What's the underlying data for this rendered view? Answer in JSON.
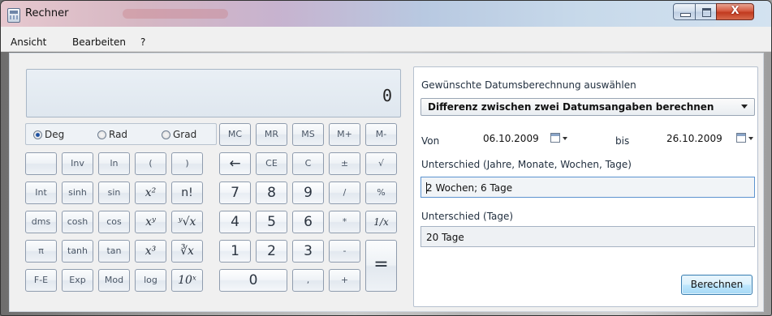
{
  "window": {
    "title": "Rechner",
    "controls": {
      "minimize": "minimize-icon",
      "maximize": "maximize-icon",
      "close": "X"
    }
  },
  "menu": [
    "Ansicht",
    "Bearbeiten",
    "?"
  ],
  "display": {
    "value": "0"
  },
  "angle_modes": [
    {
      "label": "Deg",
      "selected": true
    },
    {
      "label": "Rad",
      "selected": false
    },
    {
      "label": "Grad",
      "selected": false
    }
  ],
  "keys": {
    "row0": [
      "MC",
      "MR",
      "MS",
      "M+",
      "M-"
    ],
    "row1": [
      "",
      "Inv",
      "ln",
      "(",
      ")",
      "←",
      "CE",
      "C",
      "±",
      "√"
    ],
    "row2": [
      "Int",
      "sinh",
      "sin",
      "x²",
      "n!",
      "7",
      "8",
      "9",
      "/",
      "%"
    ],
    "row3": [
      "dms",
      "cosh",
      "cos",
      "xʸ",
      "ʸ√x",
      "4",
      "5",
      "6",
      "*",
      "1/x"
    ],
    "row4": [
      "π",
      "tanh",
      "tan",
      "x³",
      "∛x",
      "1",
      "2",
      "3",
      "-",
      "="
    ],
    "row5": [
      "F-E",
      "Exp",
      "Mod",
      "log",
      "10ˣ",
      "0",
      ",",
      "+"
    ]
  },
  "date_panel": {
    "heading": "Gewünschte Datumsberechnung auswählen",
    "mode": "Differenz zwischen zwei Datumsangaben berechnen",
    "from_label": "Von",
    "from_date": "06.10.2009",
    "to_label": "bis",
    "to_date": "26.10.2009",
    "diff_label": "Unterschied (Jahre, Monate, Wochen, Tage)",
    "diff_value": "2 Wochen; 6 Tage",
    "days_label": "Unterschied (Tage)",
    "days_value": "20 Tage",
    "calculate_label": "Berechnen"
  }
}
